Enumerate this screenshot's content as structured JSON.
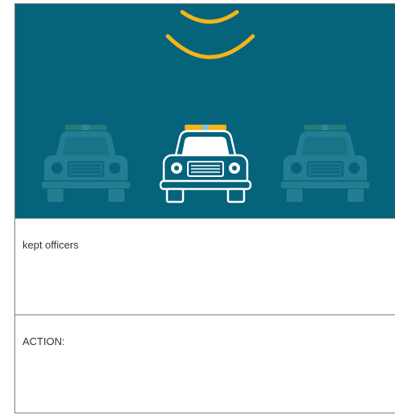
{
  "illustration": {
    "background_color": "#05637c",
    "signal_color": "#f5b418",
    "cars": [
      {
        "icon": "police-car-icon",
        "state": "dimmed"
      },
      {
        "icon": "police-car-icon",
        "state": "highlighted"
      },
      {
        "icon": "police-car-icon",
        "state": "dimmed"
      }
    ],
    "signal_icon": "signal-arcs-icon"
  },
  "caption": {
    "text": "kept officers"
  },
  "action": {
    "label": "ACTION:"
  }
}
